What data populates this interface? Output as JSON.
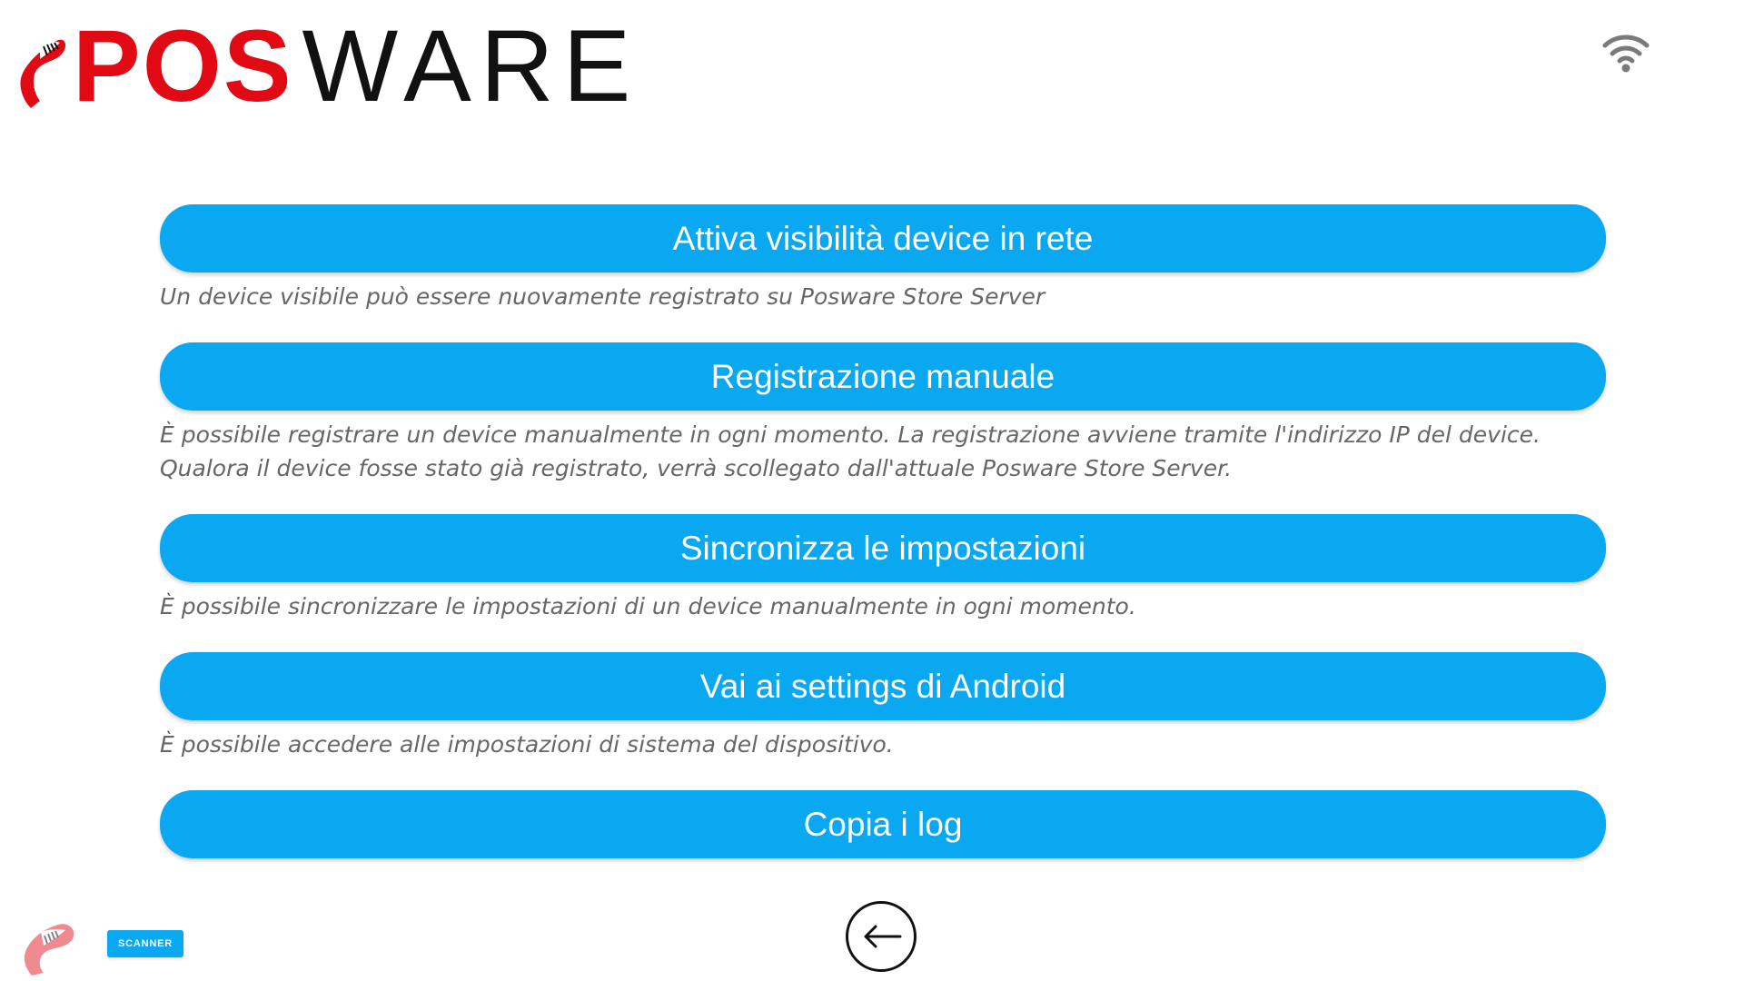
{
  "app": {
    "logo_pos": "POS",
    "logo_ware": "WARE"
  },
  "status": {
    "wifi_icon": "wifi-icon"
  },
  "menu": {
    "items": [
      {
        "label": "Attiva visibilità device in rete",
        "description": "Un device visibile può essere nuovamente registrato su Posware Store Server"
      },
      {
        "label": "Registrazione manuale",
        "description": "È possibile registrare un device manualmente in ogni momento. La registrazione avviene tramite l'indirizzo IP del device.\nQualora il device fosse stato già registrato, verrà scollegato dall'attuale Posware Store Server."
      },
      {
        "label": "Sincronizza le impostazioni",
        "description": "È possibile sincronizzare le impostazioni di un device manualmente in ogni momento."
      },
      {
        "label": "Vai ai settings di Android",
        "description": "È possibile accedere alle impostazioni di sistema del dispositivo."
      },
      {
        "label": "Copia i log"
      }
    ]
  },
  "footer": {
    "scanner_label": "SCANNER",
    "back_icon": "back-arrow-icon"
  },
  "colors": {
    "accent": "#0aa8f0",
    "brand_red": "#e10914",
    "text_gray": "#666666"
  }
}
